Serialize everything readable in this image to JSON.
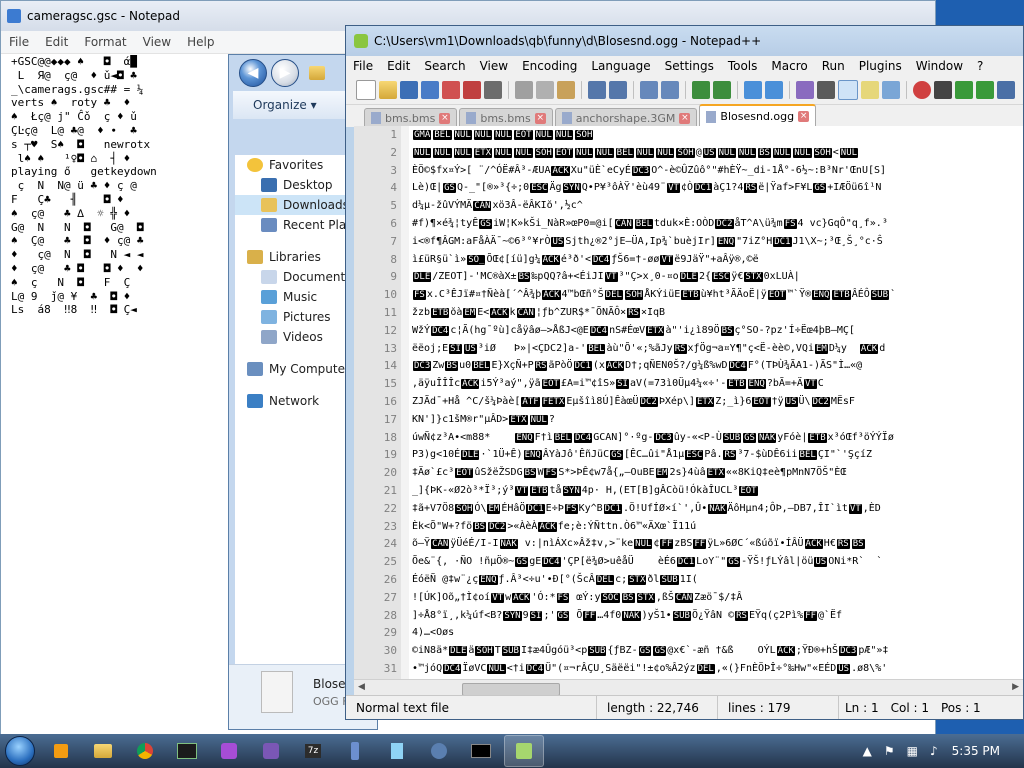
{
  "notepad": {
    "title": "cameragsc.gsc - Notepad",
    "menu": [
      "File",
      "Edit",
      "Format",
      "View",
      "Help"
    ],
    "content_lines": [
      "+GSC@@◆◆◆ ♠   ◘  ά█",
      " L  Я@  ç@  ♦ ǔ◄◘ ♣ ",
      "_\\camerags.gsc## = ¼ ",
      "verts ♠  roty ♣  ♦  ",
      "♠  Łç@ j\" Ĉǒ  ç ♦ ǔ ",
      "ÇĿç@  L@ ♣@  ♦ ∙  ♣ ",
      "s ┬♥  S♠  ◘   newrotx",
      " l♠ ♠   ¹♀◘ ⌂  ┤ ♦   ",
      "playing ő   getkeydown",
      " ç  N  N@ ü ♣ ♦ ç @ ",
      "F   Ç♣   ╢    ◘ ♦    ",
      "♠  ç@   ♣ ∆  ☼ ╬ ♦   ",
      "G@  N   N  ◘   G@  ◘ ",
      "♠  Ç@   ♣  ◘  ♦ ç@ ♣ ",
      "♦   ç@  N  ◘   N ◄ ◄ ",
      "♦  ç@   ♣ ◘   ◘ ♦  ♦ ",
      "♠  ç   N  ◘   F  Ç  ",
      "L@ 9  ǰ@ ¥  ♣  ◘ ♦   ",
      "Ls  á8  ‼8  ‼  ◘ Ç◄  "
    ]
  },
  "explorer": {
    "organize_label": "Organize ▾",
    "tree": [
      {
        "label": "Favorites",
        "kind": "star"
      },
      {
        "label": "Desktop",
        "kind": "desktop"
      },
      {
        "label": "Downloads",
        "kind": "folder",
        "selected": true
      },
      {
        "label": "Recent Places",
        "kind": "recent"
      },
      {
        "label": "",
        "kind": "spacer"
      },
      {
        "label": "Libraries",
        "kind": "library"
      },
      {
        "label": "Documents",
        "kind": "doc"
      },
      {
        "label": "Music",
        "kind": "music"
      },
      {
        "label": "Pictures",
        "kind": "pic"
      },
      {
        "label": "Videos",
        "kind": "video"
      },
      {
        "label": "",
        "kind": "spacer"
      },
      {
        "label": "My Computer",
        "kind": "computer"
      },
      {
        "label": "",
        "kind": "spacer"
      },
      {
        "label": "Network",
        "kind": "network"
      }
    ],
    "details_name": "Blose",
    "details_type": "OGG F"
  },
  "npp": {
    "title": "C:\\Users\\vm1\\Downloads\\qb\\funny\\d\\Blosesnd.ogg - Notepad++",
    "menu": [
      "File",
      "Edit",
      "Search",
      "View",
      "Encoding",
      "Language",
      "Settings",
      "Tools",
      "Macro",
      "Run",
      "Plugins",
      "Window",
      "?"
    ],
    "tabs": [
      {
        "label": "bms.bms",
        "active": false
      },
      {
        "label": "bms.bms",
        "active": false
      },
      {
        "label": "anchorshape.3GM",
        "active": false
      },
      {
        "label": "Blosesnd.ogg",
        "active": true
      }
    ],
    "lines": [
      "[GMA][BEL][NUL][NUL][NUL][EOT][NUL][NUL][SOH]",
      "[NUL][NUL][NUL][ETX][NUL][NUL][SOH][EOT][NUL][NUL][BEL][NUL][NUL][SOH]@[US][NUL][NUL][BS][NUL][NUL][SOH]<[NUL]",
      "ÈÖ©$fx¤Ý>[ ¨/^ÓË#Â³-ÆUA[ACK]Xu\"üÈ`eCyÉ[DC3]O^-è©ÛZûô°\"#hÈŸ~_di-1Å°-6½~:B³Nr'ŒnU[S]",
      "Lè)Œ|[GS]Q-_\"[®»³{÷;0[ESC]Äg[SYN]Q•P¥³ôÀŸ'èù49¨[VT]¢Ò[DC1]àÇ1?4[RS]ë|Ÿaf>F¥L[GS]+IÆÖü6î¹N",
      "d¼µ-žûVÝMÄ[CAN]xö3Â-ëÂKIŏ',½c^",
      "#f)¶×é¾¦tyÊ[GS]iW¦K»kŠi_NàR»œP0=@i[[CAN][BEL]tduk×È:OÒD[DC2]åT^A\\ü¾m[FS]4 vc}GqÔ\"q¸f».³",
      "i<®f¶ÂGM:aFåÀÄ¯~©6³°¥rÒ[US]Sjth¿®2°jE—ÜA,Ip¾`buèjIr][ENQ]\"7iZ°H[DC1]J1\\X~;³Œ¸Š¸°c·Ŝ",
      "ì£üR§ü`ì»[SO_]ÕŒ¢[íü]g¼[ACK]é³ð'<[DC4]ƒŠ6=†-øø[VT]ë9JäŸ\"+aÂÿ®,©ë",
      "[DLE]/ZEOT]-'MC®àX±[BS]‰pQQ?â+<ÉiJI[VT]³\"Ç>x¸0-¤o[DLE]2{[ESC]ÿ€[STX]0xLUÀ|",
      "[FS]x.C³ÊJï#¤†Ñèà[´^Â¾þ[ACK]4™bŒñ°Š[DEL][SOH]ÅKÝiüE[ETB]ù¥ht³ÃÄoË|ÿ[EOT]™`Ÿ®[ENQ][ETB]ÂÉÔ[SUB]`",
      "žzb[ETB]ŏà[EM]E<[ACK]k[CAN]¦ƒb^ZUR$*¯ÕNÃÔ×[RS]×IqB",
      "WžÝ[DC4]c¦Ã(hg¯ºù]cåÿâø–>ÅßJ<@E[DC4]nS#ÉœV[ETX]à\"'i¿ì89Ö[BS]ç°SO-?pz'Í÷Ëœ4þB–MÇ[",
      "ëëoj;E[SI][US]³iØ   Þ»|<ÇDC2]a-'[BEL]àù\"Õ'«;%ãJy[RS]xƒÖg¬a¤Y¶\"ç<Ë-èè©,VQi[EM]D¼y  [ACK]d",
      "[DC3]Zw[BS]u0[BEL]E}XçÑ+P[RS]ãPòÖ[DC1](x[ACK]D†;qÑEN0Š?/g¼ß%wD[DC4]F°(TÞÙ¾ÃA1-)ÃS\"Ì…«@",
      ",äÿuÎÎÎc[ACK]i5Ý³aý\",ÿã[EOT]£A=i™¢îS»[SI]aV(=73ì0Üµ4¼«÷'-[ETB][ENQ]?bÃ=+Ä[VT]C",
      "ZJÃd¯+Hå ^C/š¼Þàè[[ATF][FETX]Eµšîì8Ú]ÊàœÜ[DC2]ÞXép\\][ETX]Z;_ì}6[EOT]†ÿ[US]Ü\\[DC2]MËsF",
      "KN']}c1šM®r\"µÂD>[ETX][NUL]?",
      "úwÑ¢z³A•<m88*    [ENQ]F†ì[BEL][DC4]GCAN]°·ºg-[DC3]ûy-«<P-Ù[SUB][GS][NAK]yFóè|[ETB]x³óŒf³öÝÝÏø",
      "P3)g<10É[DLE]·`1Ü+Ê)[ENQ]ÂYàJô'ÊñJüC[GS][ÊC…ûi\"Å1µ[ESC]Pâ.[RS]³7-$ùDÊ6ii[BEL]ÇI\"`'ŞçíZ",
      "‡Äø`£c³[EOT]ûSžëŽSDG[BS]W[FS]S*>ÞÊ¢w7å{„–OuBE[EM]2s}4ùâ[ETX]««8KiQ‡eè¶pMnN7ÖŠ\"ÈŒ",
      "_]{ÞK-«Ø2ò³*Ï³;ý³[VT][ETB]tå[SYN]4p· H,(ET[B]gÂCòü!ÓkàÎUCL³[EOT]",
      "‡ã+V7Ö8[SOH]Ó\\[EM]ÉHâÖ[DC1]E÷Þ[FS]Ky^B[DC1].Ö!UfÍØ×í`',Û•[NAK]ÄôHµn4;ÔÞ,—DB7,ÎI`ìt[VT],ÈD",
      "Èk<Õ\"W+?fö[BS][DC2]>«ÀèÀ[ACK]fe;è:ÝÑttn.Ò6™«ÄXœ`Ï11ú",
      "õ–Ÿ[CAN]ÿÜéÉ/I-I[NAK] v:|nìÁXc»Âž‡v,>¨ke[NUL]¢[FF]zBS[FF]ÿL»6ØC´«ßúõï•ÍÂÜ[ACK]H€[RS][BS]",
      "Õe&¨{, ·ÑO !ñµÖ®~[GS]gE[DC4]'ÇP[ë¾Ø>uêåÜ    èÉ6[DC1]LoY¨\"[GS]-ŸŠ!ƒLÝâl|öü[US]ONi*R`  `",
      "ÉóëÑ @‡w¨¿ç[ENQ]ƒ.Â³<÷u'•Ð[°(ŠcÂ[DEL]c;[STX]ðl[SUB]1I(",
      "![ÚK]Oõ„†Ì¢oí[VT]w[ACK]'Ó:*[FS] œÝ:y[SOC][BS][STX],ßŠ[CAN]Zæö¯$/‡Â",
      "]÷Å8°ï¸,k¼úf<B?[SYN]9[SI];'[GS] Õ[FF]…4f0[NAK])yŠ1•[SUB]Ö¿ŸâN ©[RS]EŸq(ç2Pì%[FF]@`Ëf",
      "4)…<Oøs",
      "©iN8ä*[DLE]ä[SOH]T[SUB]I‡æ4Ûgóü³<p[SUB]{ƒBZ-[GS][GS]@x€`-æñ †&ß    OÝL[ACK];ŸÐ®+hŠ[DC3]pÆ\"»‡",
      "•™jóQ[DC4]ÏøVC[NUL]<†i[DC4]Ü\"(¤¬rÂÇU¸Säëëi\"!±¢o%Â2ýz[DEL],«(}FnÈÖÞÎ÷°‰Hw\"«EÉD[US].ø8\\%'",
      "•šD[DLE]™Šƒ•Ð[BS]·[DC1][SOH]ž[ZA][DC4]Èô¦ žèÐÃñ[DEL][DCI]-<ô°[US]Ø\\_Ž>rLÆb¼³[NAK]",
      "Ep«™D?ruaÜÌ2ƒCÀÀ-[DLE]e",
      "[RS] ÛÎ¼ãÐÐžéwF¯[FF]j¿2\"Z`iDšÍŸ½}[EM]SÑòqä;b¸|[ETX]:Ír`^þè4Y| ziŒ[àìxc[STX])…ú}iÚÓÓ"
    ],
    "line_numbers": [
      "1",
      "2",
      "3",
      "4",
      "5",
      "6",
      "7",
      "8",
      "9",
      "10",
      "11",
      "12",
      "13",
      "14",
      "15",
      "16",
      "17",
      "18",
      "19",
      "20",
      "21",
      "22",
      "23",
      "24",
      "25",
      "26",
      "27",
      "28",
      "29",
      "30",
      "31",
      "32",
      "33",
      "34"
    ],
    "status": {
      "mode": "Normal text file",
      "length": "length : 22,746",
      "lines": "lines : 179",
      "ln": "Ln : 1",
      "col": "Col : 1",
      "pos": "Pos : 1"
    }
  },
  "taskbar": {
    "clock": "5:35 PM"
  }
}
